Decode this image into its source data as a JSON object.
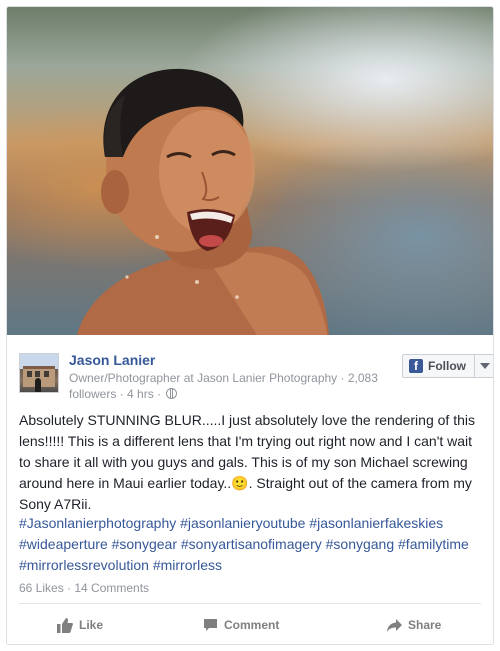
{
  "post": {
    "author": "Jason Lanier",
    "subline": "Owner/Photographer at Jason Lanier Photography · 2,083 followers · 4 hrs ·",
    "follow_label": "Follow",
    "body": "Absolutely STUNNING BLUR.....I just absolutely love the rendering of this lens!!!!! This is a different lens that I'm trying out right now and I can't wait to share it all with you guys and gals. This is of my son Michael screwing around here in Maui earlier today..🙂. Straight out of the camera from my Sony A7Rii.",
    "hashtags": "#Jasonlanierphotography #jasonlanieryoutube #jasonlanierfakeskies #wideaperture #sonygear #sonyartisanofimagery #sonygang #familytime #mirrorlessrevolution #mirrorless",
    "stats": "66 Likes · 14 Comments"
  },
  "actions": {
    "like": "Like",
    "comment": "Comment",
    "share": "Share"
  },
  "colors": {
    "link_blue": "#365899",
    "meta_gray": "#90949c",
    "facebook_blue": "#3b5998"
  },
  "icons": {
    "facebook": "facebook-icon",
    "globe": "globe-icon",
    "like": "thumbs-up-icon",
    "comment": "speech-bubble-icon",
    "share": "share-arrow-icon",
    "dropdown": "chevron-down-icon"
  }
}
